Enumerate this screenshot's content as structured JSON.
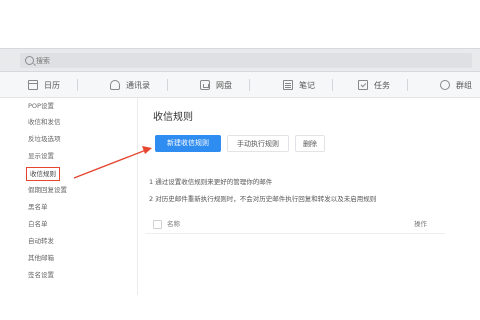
{
  "search": {
    "placeholder": "搜索"
  },
  "apps": [
    {
      "label": "日历",
      "icon": "calendar-icon"
    },
    {
      "label": "通讯录",
      "icon": "contacts-icon"
    },
    {
      "label": "网盘",
      "icon": "netdisk-icon"
    },
    {
      "label": "笔记",
      "icon": "notes-icon"
    },
    {
      "label": "任务",
      "icon": "tasks-icon"
    },
    {
      "label": "群组",
      "icon": "group-icon"
    }
  ],
  "sidebar": {
    "items": [
      {
        "label": "POP设置"
      },
      {
        "label": "收信和发信"
      },
      {
        "label": "反垃圾选项"
      },
      {
        "label": "显示设置"
      },
      {
        "label": "收信规则",
        "active": true
      },
      {
        "label": "假期回复设置"
      },
      {
        "label": "黑名单"
      },
      {
        "label": "白名单"
      },
      {
        "label": "自动转发"
      },
      {
        "label": "其他邮箱"
      },
      {
        "label": "签名设置"
      }
    ]
  },
  "main": {
    "title": "收信规则",
    "buttons": {
      "new_rule": "新建收信规则",
      "run_history": "手动执行规则",
      "delete": "删除"
    },
    "notes": [
      "1  通过设置收信规则来更好的管理你的邮件",
      "2  对历史邮件重新执行规则时，不会对历史邮件执行回复和转发以及未启用规则"
    ],
    "table": {
      "col_name": "名称",
      "col_op": "操作"
    }
  },
  "colors": {
    "primary": "#2f8cf0",
    "annotation": "#e6452f"
  }
}
